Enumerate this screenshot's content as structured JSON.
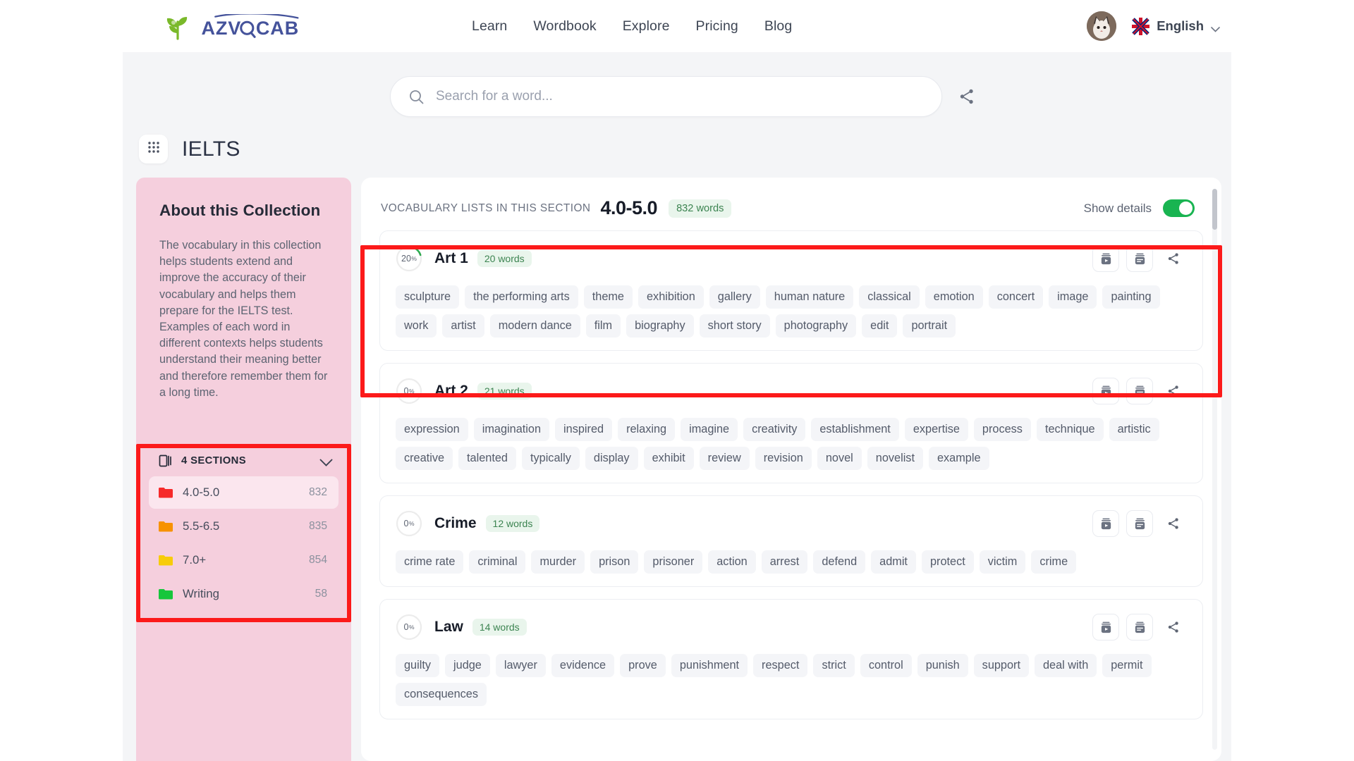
{
  "header": {
    "logo_text": "AZVOCAB",
    "nav": [
      {
        "label": "Learn"
      },
      {
        "label": "Wordbook"
      },
      {
        "label": "Explore"
      },
      {
        "label": "Pricing"
      },
      {
        "label": "Blog"
      }
    ],
    "language": "English",
    "accent_green": "#7ab92a",
    "accent_blue": "#45539b"
  },
  "search": {
    "placeholder": "Search for a word...",
    "value": ""
  },
  "collection": {
    "title": "IELTS"
  },
  "sidebar": {
    "about_heading": "About this Collection",
    "about_text": "The vocabulary in this collection helps students extend and improve the accuracy of their vocabulary and helps them prepare for the IELTS test. Examples of each word in different contexts helps students understand their meaning better and therefore remember them for a long time.",
    "sections_label": "4 SECTIONS",
    "sections": [
      {
        "label": "4.0-5.0",
        "count": "832",
        "color": "#f62a2a",
        "active": true
      },
      {
        "label": "5.5-6.5",
        "count": "835",
        "color": "#f79200",
        "active": false
      },
      {
        "label": "7.0+",
        "count": "854",
        "color": "#f7cc0a",
        "active": false
      },
      {
        "label": "Writing",
        "count": "58",
        "color": "#16c63c",
        "active": false
      }
    ],
    "panel_color": "#f5cfdd"
  },
  "main": {
    "section_label": "VOCABULARY LISTS IN THIS SECTION",
    "section_range": "4.0-5.0",
    "section_words_badge": "832 words",
    "show_details_label": "Show details",
    "show_details_on": true,
    "toggle_color": "#19b451",
    "lists": [
      {
        "progress": "20",
        "progress_suffix": "%",
        "title": "Art 1",
        "badge": "20 words",
        "words": [
          "sculpture",
          "the performing arts",
          "theme",
          "exhibition",
          "gallery",
          "human nature",
          "classical",
          "emotion",
          "concert",
          "image",
          "painting",
          "work",
          "artist",
          "modern dance",
          "film",
          "biography",
          "short story",
          "photography",
          "edit",
          "portrait"
        ]
      },
      {
        "progress": "0",
        "progress_suffix": "%",
        "title": "Art 2",
        "badge": "21 words",
        "words": [
          "expression",
          "imagination",
          "inspired",
          "relaxing",
          "imagine",
          "creativity",
          "establishment",
          "expertise",
          "process",
          "technique",
          "artistic",
          "creative",
          "talented",
          "typically",
          "display",
          "exhibit",
          "review",
          "revision",
          "novel",
          "novelist",
          "example"
        ]
      },
      {
        "progress": "0",
        "progress_suffix": "%",
        "title": "Crime",
        "badge": "12 words",
        "words": [
          "crime rate",
          "criminal",
          "murder",
          "prison",
          "prisoner",
          "action",
          "arrest",
          "defend",
          "admit",
          "protect",
          "victim",
          "crime"
        ]
      },
      {
        "progress": "0",
        "progress_suffix": "%",
        "title": "Law",
        "badge": "14 words",
        "words": [
          "guilty",
          "judge",
          "lawyer",
          "evidence",
          "prove",
          "punishment",
          "respect",
          "strict",
          "control",
          "punish",
          "support",
          "deal with",
          "permit",
          "consequences"
        ]
      }
    ]
  },
  "annotations": {
    "color": "#fc1a1a",
    "boxes": [
      "art-1-list-card",
      "sidebar-sections-panel"
    ]
  }
}
